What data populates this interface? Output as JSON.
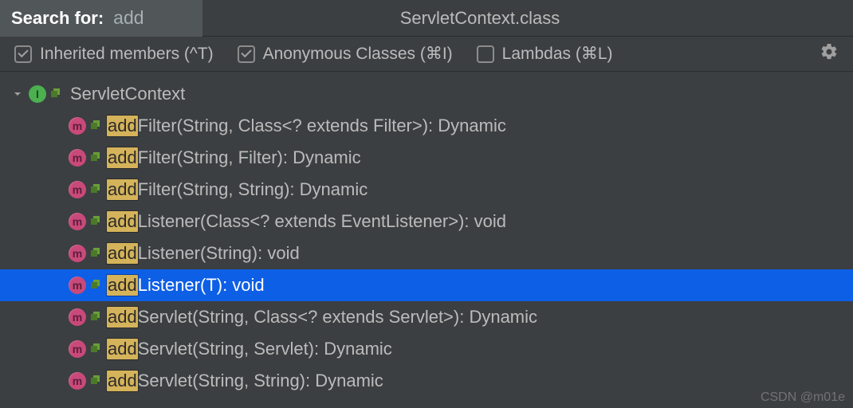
{
  "search": {
    "label": "Search for:",
    "query": "add"
  },
  "title": "ServletContext.class",
  "options": {
    "inherited": {
      "checked": true,
      "label": "Inherited members (^T)"
    },
    "anonymous": {
      "checked": true,
      "label": "Anonymous Classes (⌘I)"
    },
    "lambdas": {
      "checked": false,
      "label": "Lambdas (⌘L)"
    }
  },
  "root": {
    "icon": "I",
    "name": "ServletContext"
  },
  "members": [
    {
      "hl": "add",
      "rest": "Filter(String, Class<? extends Filter>): Dynamic",
      "selected": false
    },
    {
      "hl": "add",
      "rest": "Filter(String, Filter): Dynamic",
      "selected": false
    },
    {
      "hl": "add",
      "rest": "Filter(String, String): Dynamic",
      "selected": false
    },
    {
      "hl": "add",
      "rest": "Listener(Class<? extends EventListener>): void",
      "selected": false
    },
    {
      "hl": "add",
      "rest": "Listener(String): void",
      "selected": false
    },
    {
      "hl": "add",
      "rest": "Listener(T): void",
      "selected": true
    },
    {
      "hl": "add",
      "rest": "Servlet(String, Class<? extends Servlet>): Dynamic",
      "selected": false
    },
    {
      "hl": "add",
      "rest": "Servlet(String, Servlet): Dynamic",
      "selected": false
    },
    {
      "hl": "add",
      "rest": "Servlet(String, String): Dynamic",
      "selected": false
    }
  ],
  "watermark": "CSDN @m01e"
}
